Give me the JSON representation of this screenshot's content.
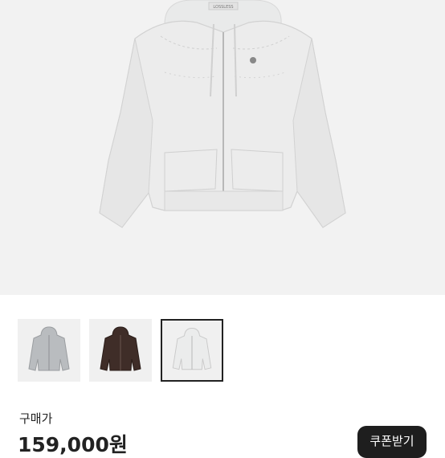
{
  "product": {
    "purchase_label": "구매가",
    "price": "159,000원",
    "coupon_button": "쿠폰받기",
    "hero_image": "white-zip-hoodie-image",
    "tag_text": "LOSSLESS"
  },
  "thumbnails": [
    {
      "name": "gray-hoodie-thumbnail",
      "color": "#b9bcbf",
      "selected": false
    },
    {
      "name": "brown-hoodie-thumbnail",
      "color": "#3f2d28",
      "selected": false
    },
    {
      "name": "white-hoodie-thumbnail",
      "color": "#ebecec",
      "selected": true
    }
  ],
  "colors": {
    "hero_bg": "#f2f2f2",
    "hoodie_white": "#ececec",
    "button_bg": "#1e1e1e"
  }
}
